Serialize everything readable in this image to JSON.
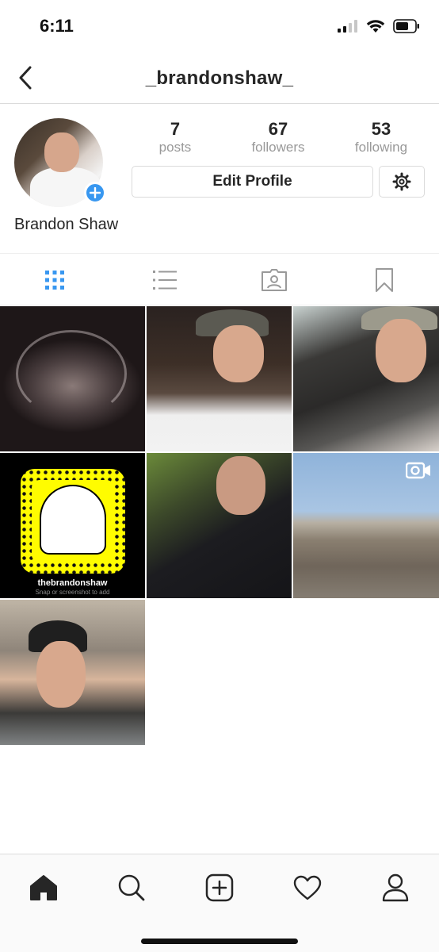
{
  "status_bar": {
    "time": "6:11",
    "icons": [
      "cellular-signal-icon",
      "wifi-icon",
      "battery-icon"
    ]
  },
  "header": {
    "back_icon": "chevron-left-icon",
    "title": "_brandonshaw_"
  },
  "profile": {
    "name": "Brandon Shaw",
    "stats": [
      {
        "value": "7",
        "label": "posts"
      },
      {
        "value": "67",
        "label": "followers"
      },
      {
        "value": "53",
        "label": "following"
      }
    ],
    "edit_profile_label": "Edit Profile",
    "settings_icon": "gear-icon",
    "add_story_icon": "plus-icon"
  },
  "view_tabs": [
    {
      "name": "grid-view",
      "icon": "grid-icon",
      "active": true
    },
    {
      "name": "list-view",
      "icon": "list-icon",
      "active": false
    },
    {
      "name": "tagged",
      "icon": "tagged-person-icon",
      "active": false
    },
    {
      "name": "saved",
      "icon": "bookmark-icon",
      "active": false
    }
  ],
  "posts": {
    "snapcode": {
      "username": "thebrandonshaw",
      "caption": "Snap or screenshot to add"
    },
    "video_badge_icon": "video-camera-icon"
  },
  "tab_bar": [
    "home-icon",
    "search-icon",
    "new-post-icon",
    "heart-icon",
    "profile-icon"
  ],
  "colors": {
    "accent": "#3897f0",
    "text": "#262626",
    "muted": "#999999",
    "border": "#dbdbdb",
    "snapchat_yellow": "#fffc00"
  }
}
